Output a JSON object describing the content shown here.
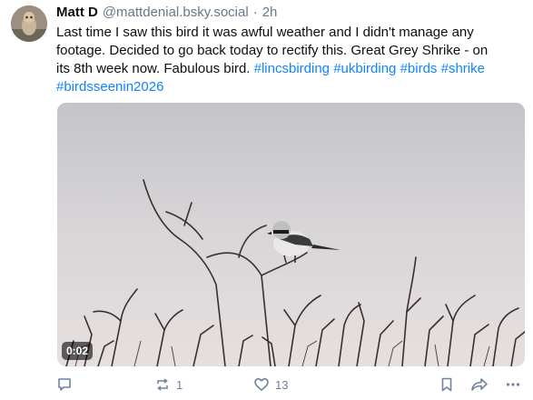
{
  "post": {
    "author": {
      "display_name": "Matt D",
      "handle": "@mattdenial.bsky.social",
      "separator": "·",
      "time": "2h"
    },
    "text_lines": [
      "Last time I saw this bird it was awful weather and I didn't manage any",
      "footage. Decided to go back today to rectify this. Great Grey Shrike - on"
    ],
    "text_line3_prefix": "its 8th week now. Fabulous bird. ",
    "hashtags": [
      "#lincsbirding",
      "#ukbirding",
      "#birds",
      "#shrike",
      "#birdsseenin2026"
    ],
    "video": {
      "duration": "0:02"
    },
    "actions": {
      "reply_icon": "speech-bubble-icon",
      "repost_count": "1",
      "like_count": "13",
      "bookmark_icon": "bookmark-icon",
      "share_icon": "share-arrow-icon",
      "more_icon": "ellipsis-icon"
    }
  },
  "colors": {
    "hashtag": "#1083fe",
    "meta_text": "#66788a",
    "action_icon": "#6f839f"
  }
}
